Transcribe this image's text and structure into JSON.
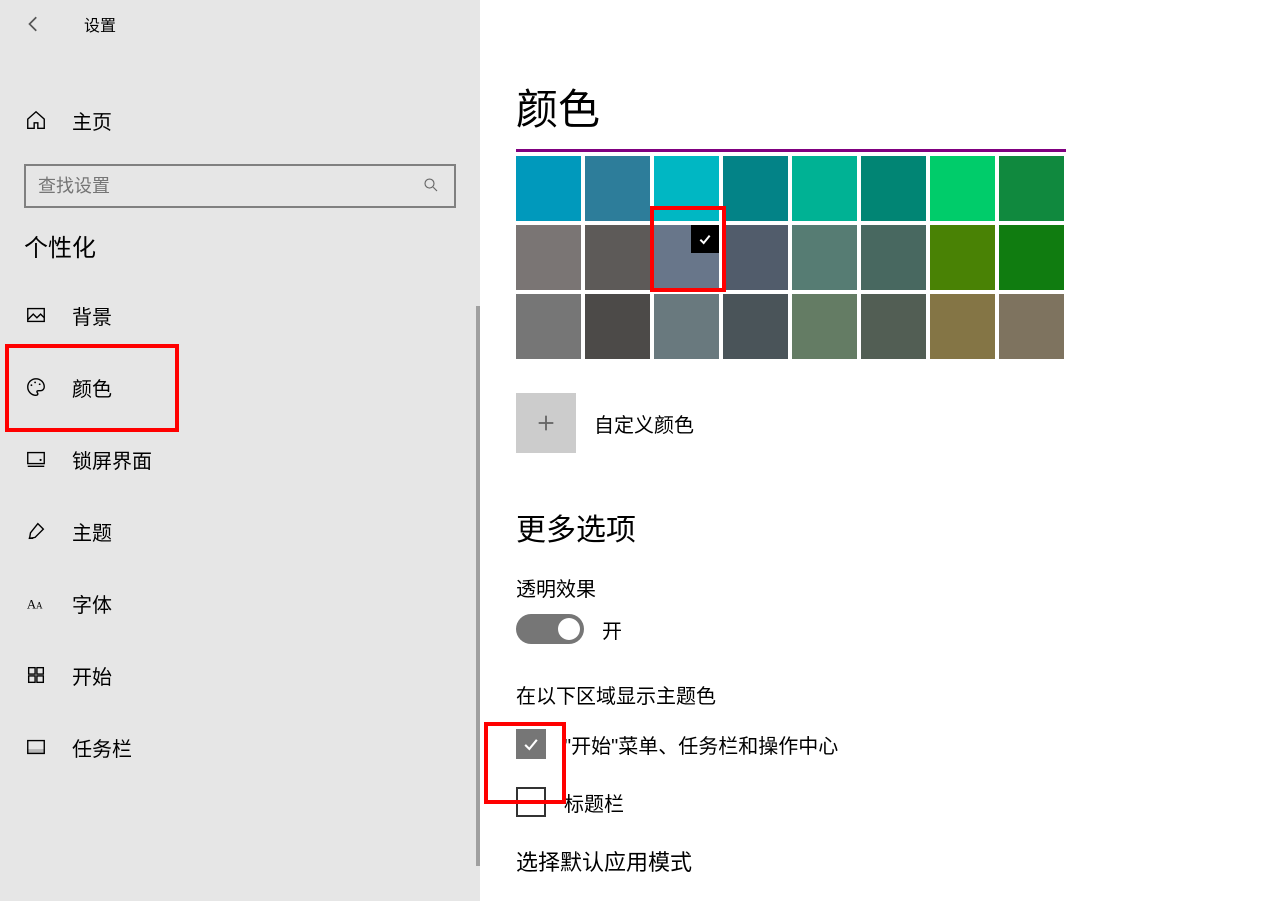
{
  "header": {
    "title": "设置"
  },
  "sidebar": {
    "home_label": "主页",
    "search_placeholder": "查找设置",
    "section_title": "个性化",
    "items": [
      {
        "label": "背景",
        "icon": "picture-icon"
      },
      {
        "label": "颜色",
        "icon": "palette-icon",
        "active": true
      },
      {
        "label": "锁屏界面",
        "icon": "lock-screen-icon"
      },
      {
        "label": "主题",
        "icon": "brush-icon"
      },
      {
        "label": "字体",
        "icon": "font-icon"
      },
      {
        "label": "开始",
        "icon": "start-icon"
      },
      {
        "label": "任务栏",
        "icon": "taskbar-icon"
      }
    ]
  },
  "main": {
    "title": "颜色",
    "colors": {
      "row1": [
        "#0099bc",
        "#2d7d9a",
        "#00b7c3",
        "#038387",
        "#00b294",
        "#018574",
        "#00cc6a",
        "#10893e"
      ],
      "row2": [
        "#7a7574",
        "#5d5a58",
        "#68768a",
        "#515c6b",
        "#567c73",
        "#486860",
        "#498205",
        "#107c10"
      ],
      "row3": [
        "#767676",
        "#4c4a48",
        "#69797e",
        "#4a5459",
        "#647c64",
        "#525e54",
        "#847545",
        "#7e735f"
      ],
      "selected_index": 10
    },
    "custom_color_label": "自定义颜色",
    "more_options_title": "更多选项",
    "transparency_label": "透明效果",
    "transparency_state": "开",
    "show_accent_label": "在以下区域显示主题色",
    "checkbox1_label": "\"开始\"菜单、任务栏和操作中心",
    "checkbox1_checked": true,
    "checkbox2_label": "标题栏",
    "checkbox2_checked": false,
    "cutoff_text": "选择默认应用模式"
  }
}
